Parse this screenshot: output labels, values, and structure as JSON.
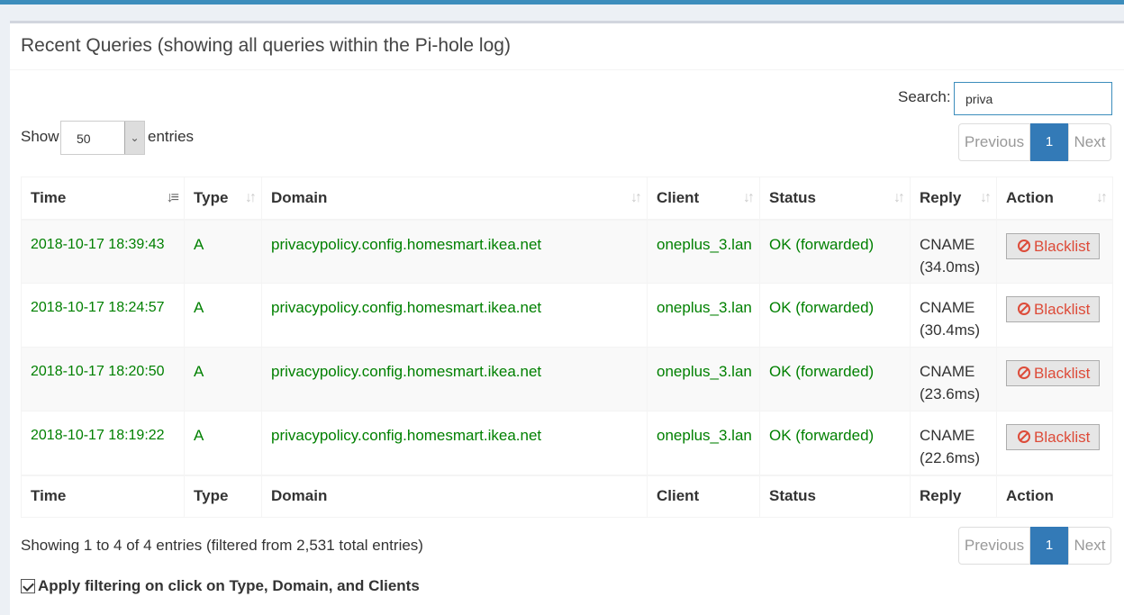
{
  "header": {
    "title": "Recent Queries (showing all queries within the Pi-hole log)"
  },
  "search": {
    "label": "Search:",
    "value": "priva"
  },
  "length": {
    "show_label": "Show",
    "selected": "50",
    "entries_label": "entries"
  },
  "pagination": {
    "previous": "Previous",
    "current": "1",
    "next": "Next"
  },
  "table": {
    "columns": [
      "Time",
      "Type",
      "Domain",
      "Client",
      "Status",
      "Reply",
      "Action"
    ],
    "rows": [
      {
        "time": "2018-10-17 18:39:43",
        "type": "A",
        "domain": "privacypolicy.config.homesmart.ikea.net",
        "client": "oneplus_3.lan",
        "status": "OK (forwarded)",
        "reply": "CNAME",
        "reply_time": "(34.0ms)",
        "action": "Blacklist"
      },
      {
        "time": "2018-10-17 18:24:57",
        "type": "A",
        "domain": "privacypolicy.config.homesmart.ikea.net",
        "client": "oneplus_3.lan",
        "status": "OK (forwarded)",
        "reply": "CNAME",
        "reply_time": "(30.4ms)",
        "action": "Blacklist"
      },
      {
        "time": "2018-10-17 18:20:50",
        "type": "A",
        "domain": "privacypolicy.config.homesmart.ikea.net",
        "client": "oneplus_3.lan",
        "status": "OK (forwarded)",
        "reply": "CNAME",
        "reply_time": "(23.6ms)",
        "action": "Blacklist"
      },
      {
        "time": "2018-10-17 18:19:22",
        "type": "A",
        "domain": "privacypolicy.config.homesmart.ikea.net",
        "client": "oneplus_3.lan",
        "status": "OK (forwarded)",
        "reply": "CNAME",
        "reply_time": "(22.6ms)",
        "action": "Blacklist"
      }
    ]
  },
  "info": "Showing 1 to 4 of 4 entries (filtered from 2,531 total entries)",
  "apply_filter": {
    "label": "Apply filtering on click on Type, Domain, and Clients",
    "checked": true
  },
  "colors": {
    "accent": "#3c8dbc",
    "allowed_text": "#008000",
    "blacklist_red": "#dd4b39",
    "page_active": "#337ab7"
  },
  "icons": {
    "sort": "sort-icon",
    "ban": "ban-icon",
    "checkbox": "checkbox-icon",
    "dropdown": "chevron-down-icon"
  }
}
